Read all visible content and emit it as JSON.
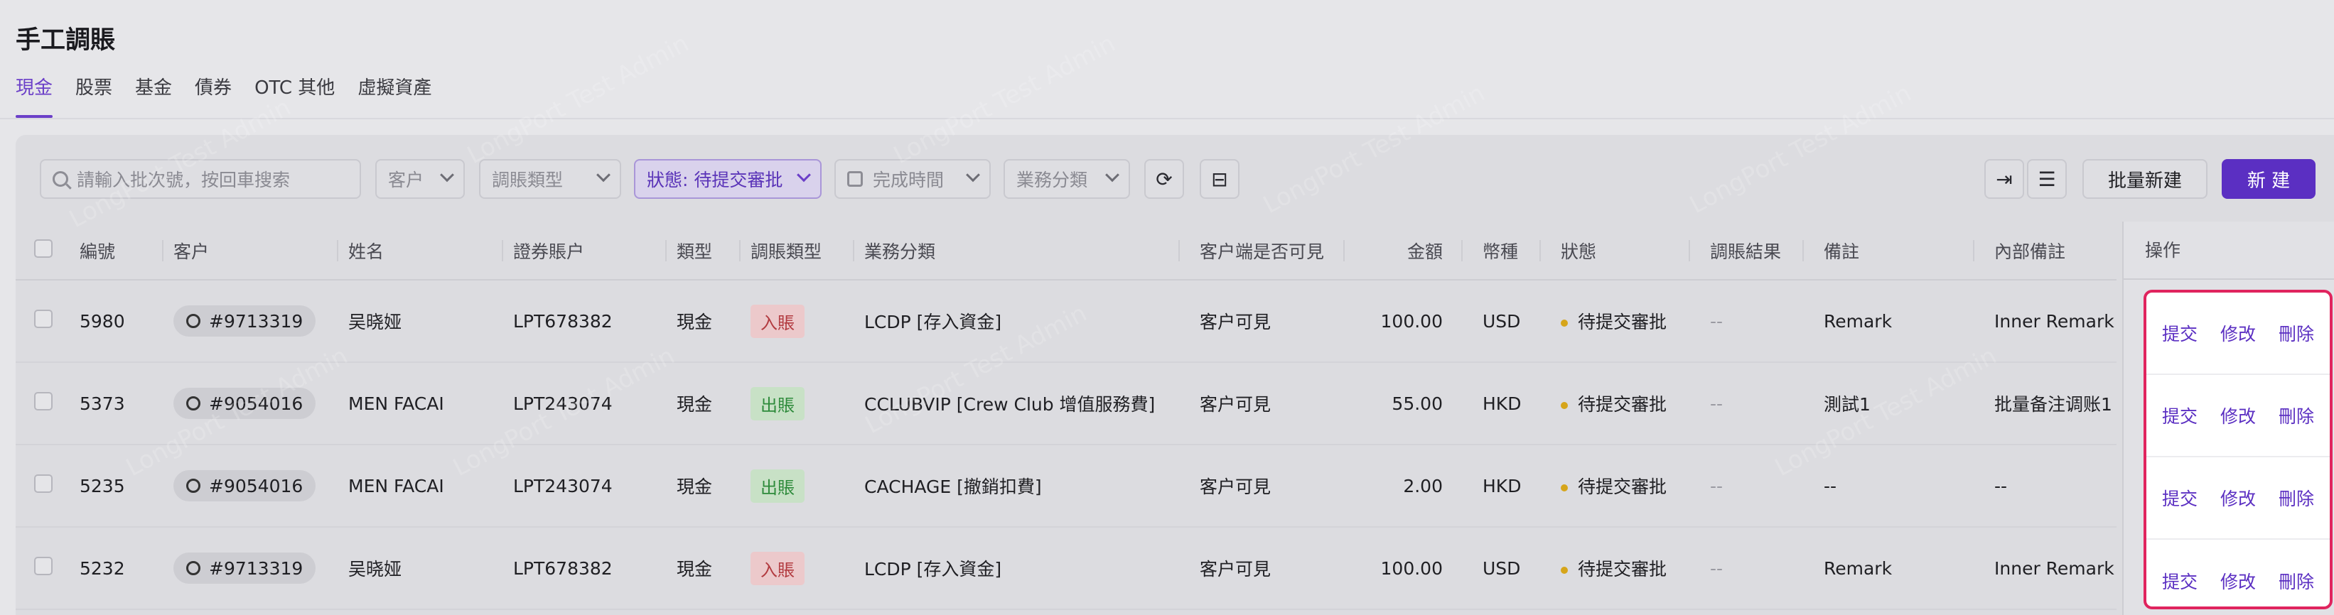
{
  "page": {
    "title": "手工調賬"
  },
  "tabs": [
    {
      "label": "現金"
    },
    {
      "label": "股票"
    },
    {
      "label": "基金"
    },
    {
      "label": "債券"
    },
    {
      "label": "OTC 其他"
    },
    {
      "label": "虛擬資產"
    }
  ],
  "toolbar": {
    "search_placeholder": "請輸入批次號，按回車搜索",
    "customer": "客户",
    "adjust_type": "調賬類型",
    "status": "狀態: 待提交審批",
    "done_time": "完成時間",
    "biz_category": "業務分類",
    "batch_new": "批量新建",
    "new": "新 建"
  },
  "watermark": "LongPort Test Admin",
  "table": {
    "headers": {
      "id": "編號",
      "customer": "客户",
      "name": "姓名",
      "account": "證券賬户",
      "type": "類型",
      "adjust_type": "調賬類型",
      "biz": "業務分類",
      "visible": "客户端是否可見",
      "amount": "金額",
      "currency": "幣種",
      "status": "狀態",
      "result": "調賬結果",
      "remark": "備註",
      "inner_remark": "內部備註",
      "ops": "操作"
    },
    "rows": [
      {
        "id": "5980",
        "customer": "#9713319",
        "name": "吴晓娅",
        "account": "LPT678382",
        "type": "現金",
        "adjust_type": "入賬",
        "direction": "in",
        "biz": "LCDP [存入資金]",
        "visible": "客户可見",
        "amount": "100.00",
        "currency": "USD",
        "status": "待提交審批",
        "result": "--",
        "remark": "Remark",
        "inner_remark": "Inner Remark"
      },
      {
        "id": "5373",
        "customer": "#9054016",
        "name": "MEN FACAI",
        "account": "LPT243074",
        "type": "現金",
        "adjust_type": "出賬",
        "direction": "out",
        "biz": "CCLUBVIP [Crew Club 增值服務費]",
        "visible": "客户可見",
        "amount": "55.00",
        "currency": "HKD",
        "status": "待提交審批",
        "result": "--",
        "remark": "測試1",
        "inner_remark": "批量备注调账1"
      },
      {
        "id": "5235",
        "customer": "#9054016",
        "name": "MEN FACAI",
        "account": "LPT243074",
        "type": "現金",
        "adjust_type": "出賬",
        "direction": "out",
        "biz": "CACHAGE [撤銷扣費]",
        "visible": "客户可見",
        "amount": "2.00",
        "currency": "HKD",
        "status": "待提交審批",
        "result": "--",
        "remark": "--",
        "inner_remark": "--"
      },
      {
        "id": "5232",
        "customer": "#9713319",
        "name": "吴晓娅",
        "account": "LPT678382",
        "type": "現金",
        "adjust_type": "入賬",
        "direction": "in",
        "biz": "LCDP [存入資金]",
        "visible": "客户可見",
        "amount": "100.00",
        "currency": "USD",
        "status": "待提交審批",
        "result": "--",
        "remark": "Remark",
        "inner_remark": "Inner Remark"
      }
    ],
    "ops": {
      "submit": "提交",
      "edit": "修改",
      "delete": "刪除"
    }
  },
  "colors": {
    "accent": "#5b2fc2",
    "highlight": "#e0245e",
    "pending_dot": "#d6a51a"
  },
  "icons": [
    "search-icon",
    "chevron-down-icon",
    "calendar-icon",
    "refresh-icon",
    "gift-icon",
    "export-icon",
    "column-settings-icon",
    "person-icon"
  ]
}
